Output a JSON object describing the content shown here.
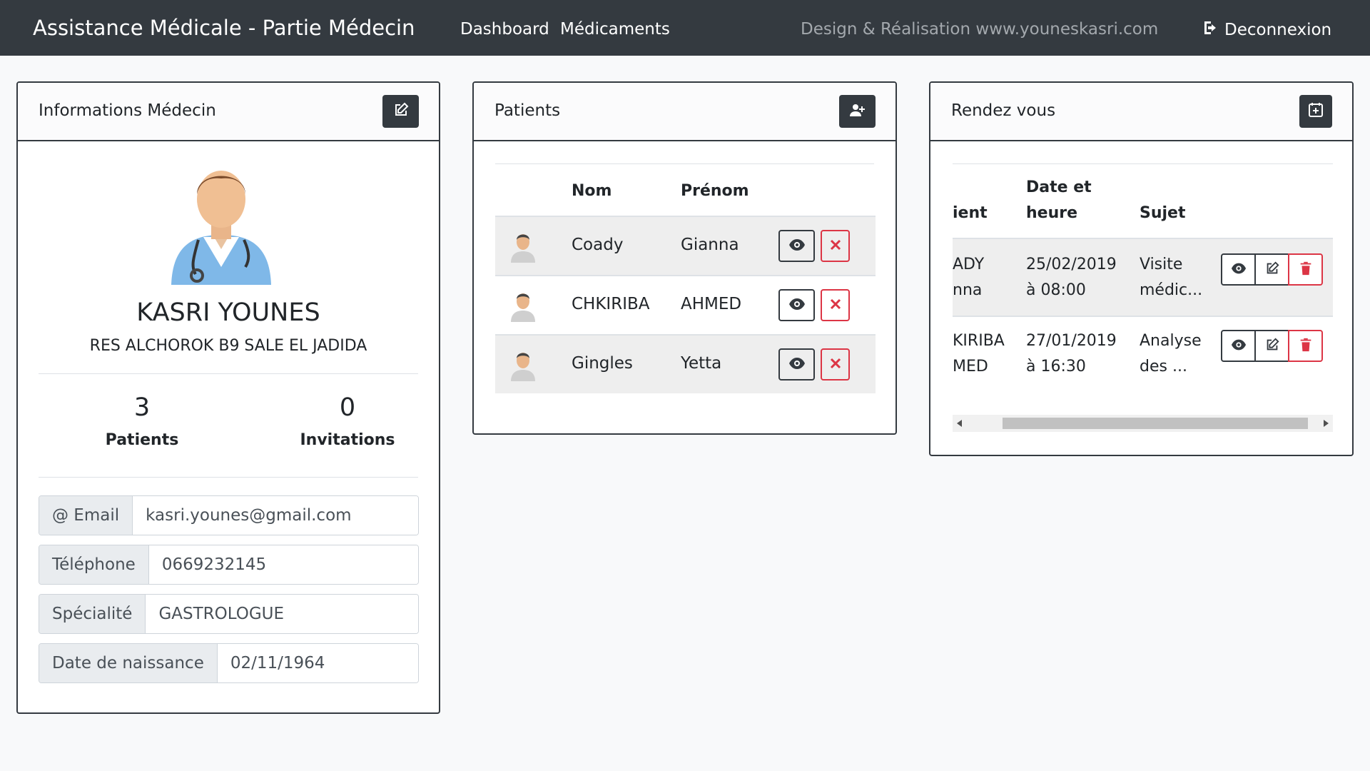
{
  "navbar": {
    "brand": "Assistance Médicale - Partie Médecin",
    "links": [
      "Dashboard",
      "Médicaments"
    ],
    "credit": "Design & Réalisation www.youneskasri.com",
    "logout": "Deconnexion"
  },
  "doctor_card": {
    "title": "Informations Médecin",
    "name": "KASRI YOUNES",
    "address": "RES ALCHOROK B9 SALE EL JADIDA",
    "stats": [
      {
        "value": "3",
        "label": "Patients"
      },
      {
        "value": "0",
        "label": "Invitations"
      }
    ],
    "fields": [
      {
        "label": "@ Email",
        "value": "kasri.younes@gmail.com"
      },
      {
        "label": "Téléphone",
        "value": "0669232145"
      },
      {
        "label": "Spécialité",
        "value": "GASTROLOGUE"
      },
      {
        "label": "Date de naissance",
        "value": "02/11/1964"
      }
    ]
  },
  "patients_card": {
    "title": "Patients",
    "columns": [
      "Nom",
      "Prénom"
    ],
    "rows": [
      {
        "nom": "Coady",
        "prenom": "Gianna"
      },
      {
        "nom": "CHKIRIBA",
        "prenom": "AHMED"
      },
      {
        "nom": "Gingles",
        "prenom": "Yetta"
      }
    ]
  },
  "rdv_card": {
    "title": "Rendez vous",
    "columns": {
      "patient": "ient",
      "date_1": "Date et",
      "date_2": "heure",
      "subject": "Sujet"
    },
    "rows": [
      {
        "patient_1": "ADY",
        "patient_2": "nna",
        "date_1": "25/02/2019",
        "date_2": "à 08:00",
        "subject_1": "Visite",
        "subject_2": "médic..."
      },
      {
        "patient_1": "KIRIBA",
        "patient_2": "MED",
        "date_1": "27/01/2019",
        "date_2": "à 16:30",
        "subject_1": "Analyse",
        "subject_2": "des ..."
      }
    ]
  },
  "icons": {
    "logout": "sign-out-icon",
    "edit": "edit-icon",
    "add_user": "user-plus-icon",
    "calendar": "calendar-plus-icon",
    "view": "eye-icon",
    "delete": "times-icon",
    "trash": "trash-icon"
  },
  "colors": {
    "navbar": "#343a40",
    "danger": "#dc3545",
    "background": "#f8f9fa"
  }
}
